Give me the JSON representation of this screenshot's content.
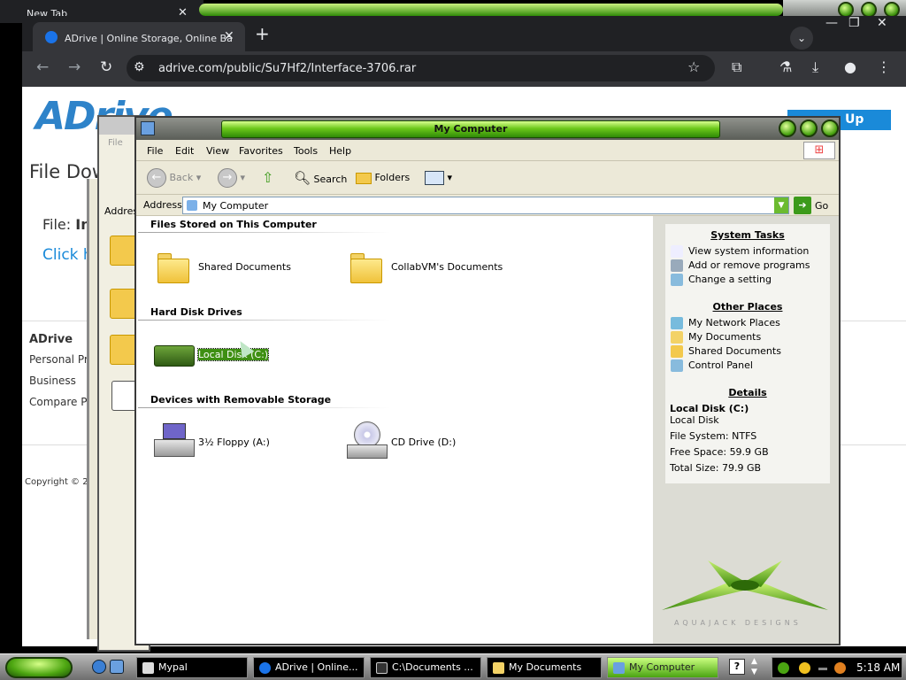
{
  "browser": {
    "back_tab_title": "New Tab",
    "active_tab_title": "ADrive | Online Storage, Online Ba",
    "url": "adrive.com/public/Su7Hf2/Interface-3706.rar"
  },
  "webpage": {
    "logo": "ADrive",
    "heading": "File Dow",
    "file_label": "File:",
    "file_name_partial": "In",
    "click_text": "Click h",
    "signup": "Up",
    "footer_title": "ADrive",
    "footer_links": [
      "Personal Pr",
      "Business",
      "Compare Pl"
    ],
    "copyright": "Copyright © 20"
  },
  "background_window": {
    "menu": "File",
    "address_label": "Addres"
  },
  "explorer": {
    "title": "My Computer",
    "menu": [
      "File",
      "Edit",
      "View",
      "Favorites",
      "Tools",
      "Help"
    ],
    "toolbar": {
      "back": "Back",
      "search": "Search",
      "folders": "Folders"
    },
    "address_label": "Address",
    "address_value": "My Computer",
    "go": "Go",
    "sections": {
      "stored": "Files Stored on This Computer",
      "hdd": "Hard Disk Drives",
      "removable": "Devices with Removable Storage"
    },
    "items": {
      "shared_docs": "Shared Documents",
      "collab_docs": "CollabVM's Documents",
      "local_disk": "Local Disk (C:)",
      "floppy": "3½ Floppy (A:)",
      "cd": "CD Drive (D:)"
    },
    "side": {
      "system_tasks": "System Tasks",
      "system_links": [
        "View system information",
        "Add or remove programs",
        "Change a setting"
      ],
      "other_places": "Other Places",
      "other_links": [
        "My Network Places",
        "My Documents",
        "Shared Documents",
        "Control Panel"
      ],
      "details": "Details",
      "details_name": "Local Disk (C:)",
      "details_type": "Local Disk",
      "file_system": "File System: NTFS",
      "free_space": "Free Space: 59.9 GB",
      "total_size": "Total Size: 79.9 GB",
      "brand_caption": "AQUAJACK DESIGNS"
    }
  },
  "taskbar": {
    "tasks": [
      "Mypal",
      "ADrive | Online...",
      "C:\\Documents ...",
      "My Documents",
      "My Computer"
    ],
    "clock": "5:18 AM"
  },
  "colors": {
    "accent_green": "#4aa412",
    "adrive_blue": "#2e83c9"
  }
}
